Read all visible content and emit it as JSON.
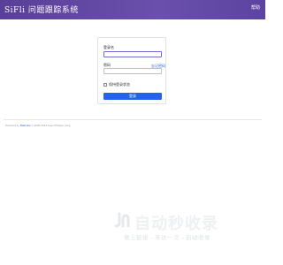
{
  "header": {
    "app_title": "SiFli 问题跟踪系统",
    "help_label": "帮助"
  },
  "login": {
    "username_label": "登录名",
    "password_label": "密码",
    "forgot_password": "忘记密码",
    "remember_label": "保持登录状态",
    "submit_label": "登录",
    "accent_color": "#2563eb"
  },
  "footer": {
    "prefix": "Powered by",
    "brand": "Redmine",
    "suffix": "© 2006-2023 Jean-Philippe Lang"
  },
  "watermark": {
    "title": "自动秒收录",
    "subtitle": "做上链接→来访一次→自动收录",
    "logo_icon": "jn-logo-icon"
  }
}
